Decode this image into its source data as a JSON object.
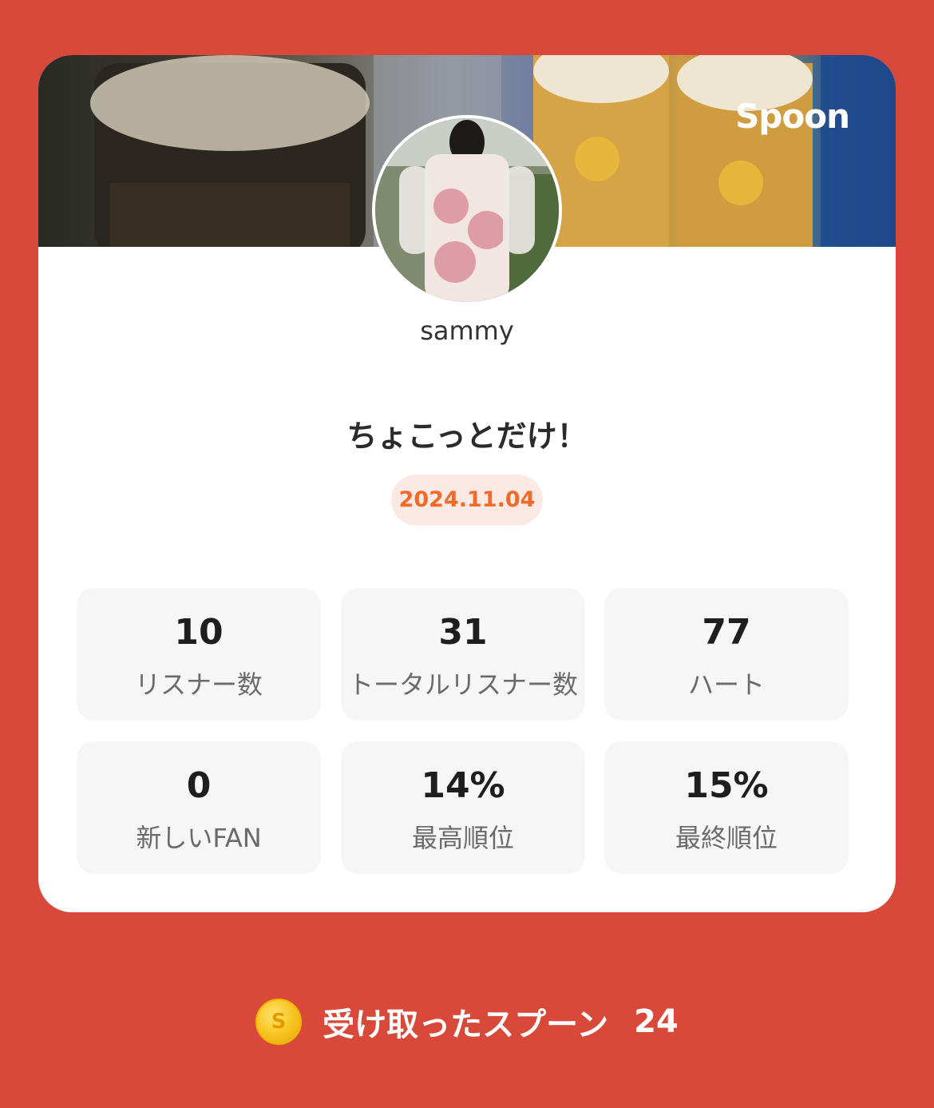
{
  "brand": "Spoon",
  "profile": {
    "username": "sammy",
    "avatar_icon": "user-photo"
  },
  "live": {
    "title": "ちょこっとだけ！",
    "date": "2024.11.04"
  },
  "stats": [
    {
      "value": "10",
      "label": "リスナー数"
    },
    {
      "value": "31",
      "label": "トータルリスナー数"
    },
    {
      "value": "77",
      "label": "ハート"
    },
    {
      "value": "0",
      "label": "新しいFAN"
    },
    {
      "value": "14%",
      "label": "最高順位"
    },
    {
      "value": "15%",
      "label": "最終順位"
    }
  ],
  "footer": {
    "coin_icon": "spoon-coin-icon",
    "coin_letter": "S",
    "label": "受け取ったスプーン",
    "count": "24"
  },
  "colors": {
    "background": "#d9493a",
    "date_accent": "#f06a2a",
    "date_badge_bg": "#fde9e3",
    "stat_bg": "#f6f6f6"
  }
}
